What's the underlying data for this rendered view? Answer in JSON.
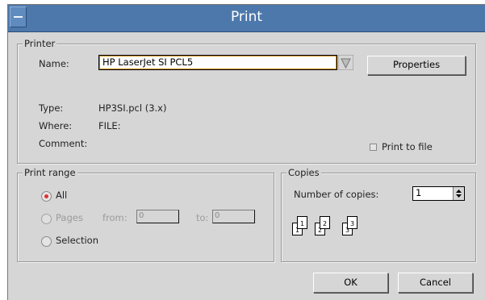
{
  "window": {
    "title": "Print"
  },
  "printer": {
    "legend": "Printer",
    "name_label": "Name:",
    "name_value": "HP LaserJet SI PCL5",
    "properties_button": "Properties",
    "type_label": "Type:",
    "type_value": "HP3SI.pcl (3.x)",
    "where_label": "Where:",
    "where_value": "FILE:",
    "comment_label": "Comment:",
    "print_to_file_label": "Print to file"
  },
  "print_range": {
    "legend": "Print range",
    "all_label": "All",
    "pages_label": "Pages",
    "from_label": "from:",
    "from_value": "0",
    "to_label": "to:",
    "to_value": "0",
    "selection_label": "Selection",
    "selected": "All"
  },
  "copies": {
    "legend": "Copies",
    "number_label": "Number of copies:",
    "number_value": "1",
    "collate_pages": [
      "1",
      "1",
      "2",
      "2",
      "3",
      "3"
    ]
  },
  "buttons": {
    "ok": "OK",
    "cancel": "Cancel"
  },
  "colors": {
    "titlebar": "#4d78ab",
    "dialog": "#d6d6d6",
    "radio_selected": "#e03030",
    "focus_border": "#c88a00"
  }
}
